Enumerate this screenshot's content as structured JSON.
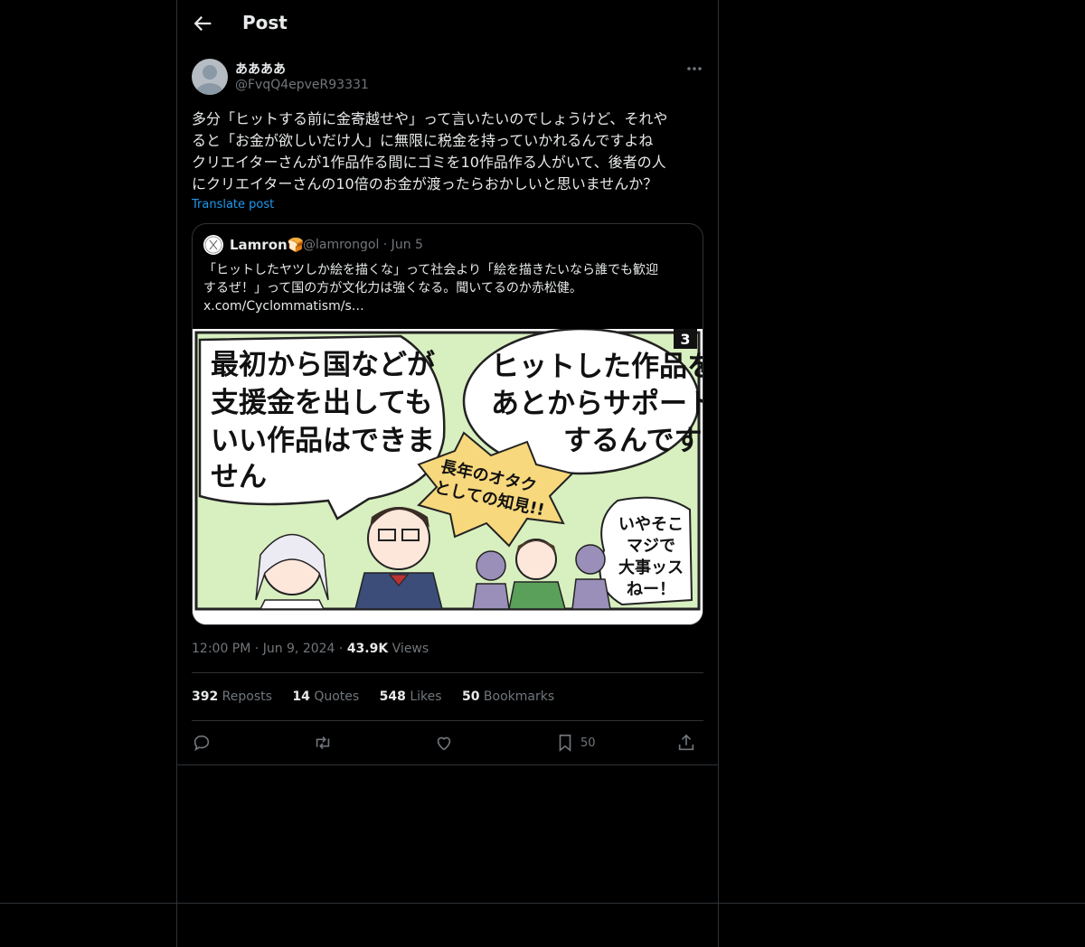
{
  "header": {
    "title": "Post"
  },
  "author": {
    "name": "ああああ",
    "handle": "@FvqQ4epveR93331"
  },
  "post": {
    "lines": [
      "多分「ヒットする前に金寄越せや」って言いたいのでしょうけど、それや",
      "ると「お金が欲しいだけ人」に無限に税金を持っていかれるんですよね",
      "クリエイターさんが1作品作る間にゴミを10作品作る人がいて、後者の人",
      "にクリエイターさんの10倍のお金が渡ったらおかしいと思いませんか？"
    ],
    "translate": "Translate post"
  },
  "quote": {
    "name": "Lamron",
    "name_emoji": "🍞",
    "handle_date": "@lamrongol · Jun 5",
    "lines": [
      "「ヒットしたヤツしか絵を描くな」って社会より「絵を描きたいなら誰でも歓迎",
      "するぜ！」って国の方が文化力は強くなる。聞いてるのか赤松健。",
      "x.com/Cyclommatism/s…"
    ],
    "manga": {
      "bubble_left": [
        "最初から国などが",
        "支援金を出しても",
        "いい作品はできま",
        "せん"
      ],
      "bubble_right": [
        "ヒットした作品を",
        "あとからサポート",
        "するんです"
      ],
      "burst": [
        "長年のオタク",
        "としての知見!!"
      ],
      "bubble_small": [
        "いやそこ",
        "マジで",
        "大事ッス",
        "ねー！"
      ],
      "page_num": "3"
    }
  },
  "meta": {
    "time": "12:00 PM",
    "sep1": " · ",
    "date": "Jun 9, 2024",
    "sep2": " · ",
    "views_num": "43.9K",
    "views_label": " Views"
  },
  "stats": {
    "reposts_num": "392",
    "reposts_label": " Reposts",
    "quotes_num": "14",
    "quotes_label": " Quotes",
    "likes_num": "548",
    "likes_label": " Likes",
    "bookmarks_num": "50",
    "bookmarks_label": " Bookmarks"
  },
  "actions": {
    "bookmark_count": "50"
  },
  "colors": {
    "accent": "#1d9bf0",
    "border": "#2f3336",
    "muted": "#71767b",
    "manga_bg": "#d8efc0"
  },
  "icons": [
    "arrow-left-icon",
    "more-icon",
    "reply-icon",
    "repost-icon",
    "like-icon",
    "bookmark-icon",
    "share-icon"
  ]
}
